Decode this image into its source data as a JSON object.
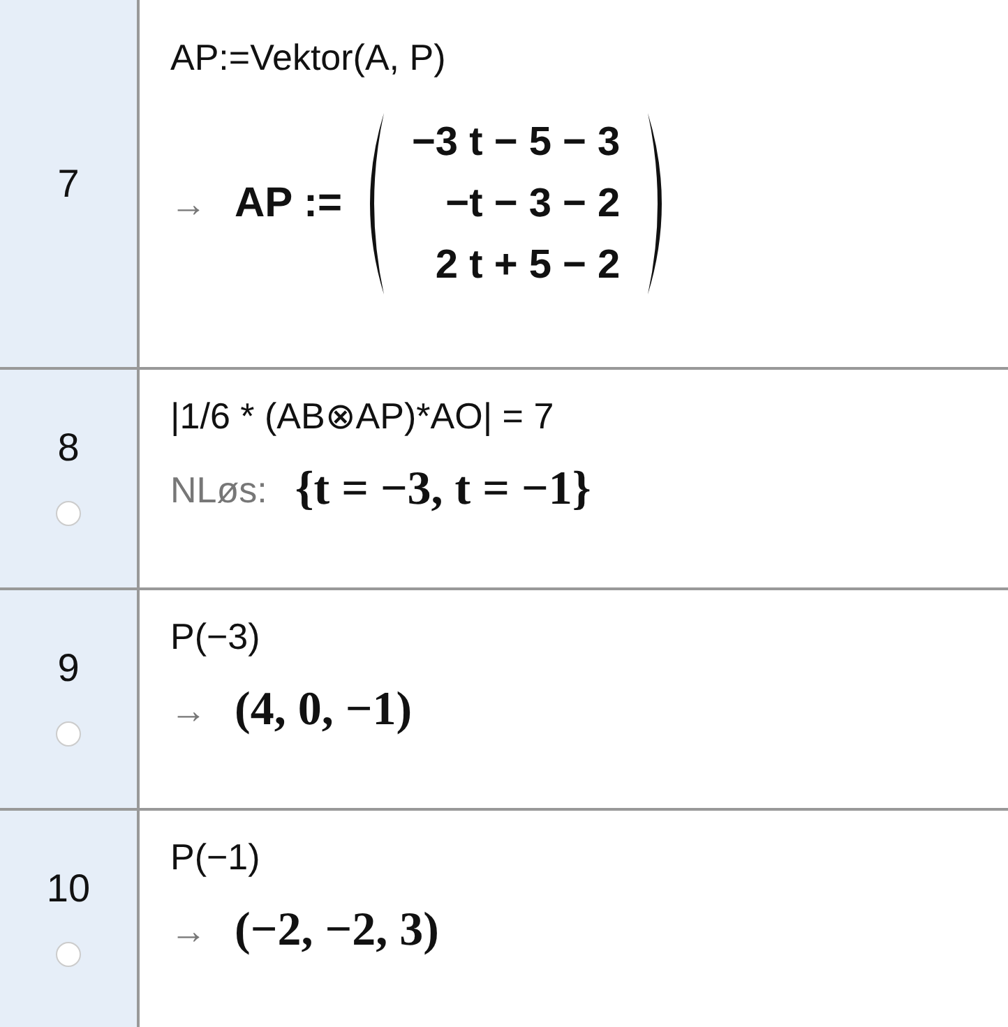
{
  "rows": [
    {
      "number": "7",
      "input": "AP:=Vektor(A, P)",
      "output": {
        "kind": "vector",
        "arrow": "→",
        "name": "AP :=",
        "entries": [
          "−3 t − 5 − 3",
          "−t − 3 − 2",
          "2 t + 5 − 2"
        ]
      }
    },
    {
      "number": "8",
      "visible": false,
      "input": "|1/6 * (AB⊗AP)*AO| = 7",
      "output": {
        "kind": "solution",
        "label": "NLøs:",
        "value": "{t = −3, t = −1}"
      }
    },
    {
      "number": "9",
      "visible": false,
      "input": "P(−3)",
      "output": {
        "kind": "value",
        "arrow": "→",
        "value": "(4, 0, −1)"
      }
    },
    {
      "number": "10",
      "visible": false,
      "input": "P(−1)",
      "output": {
        "kind": "value",
        "arrow": "→",
        "value": "(−2, −2, 3)"
      }
    }
  ]
}
